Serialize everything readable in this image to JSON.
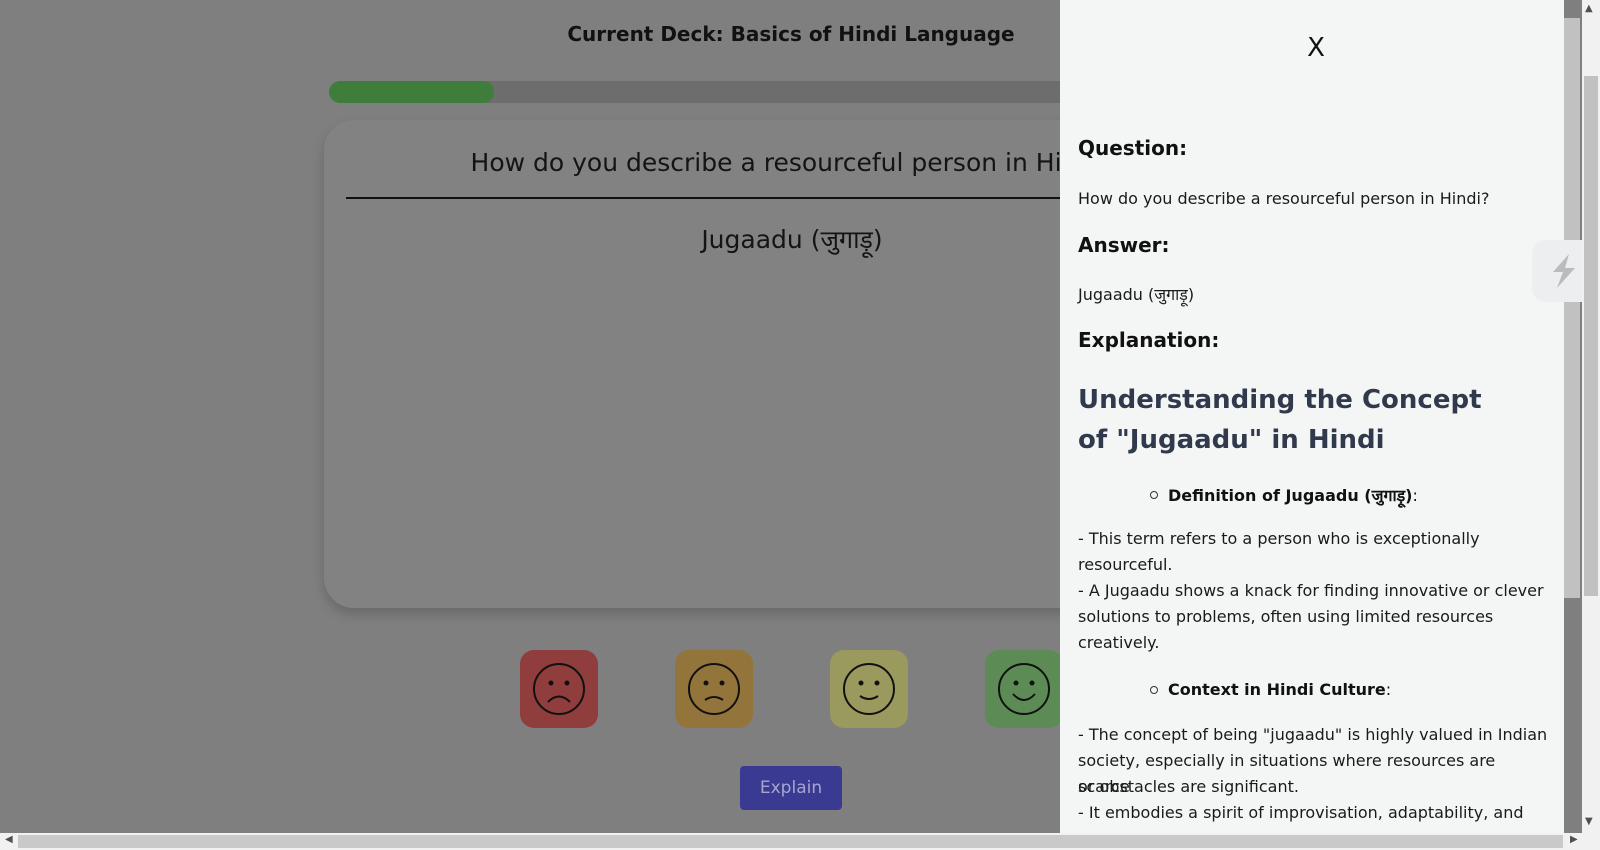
{
  "deck": {
    "title": "Current Deck: Basics of Hindi Language"
  },
  "progress": {
    "fraction": 0.168
  },
  "card": {
    "question": "How do you describe a resourceful person in Hindi?",
    "answer": "Jugaadu (जुगाड़ू)"
  },
  "rating_buttons": [
    {
      "name": "very-sad",
      "color": "#8f3d3d"
    },
    {
      "name": "sad",
      "color": "#93753b"
    },
    {
      "name": "happy",
      "color": "#9a9a5e"
    },
    {
      "name": "very-happy",
      "color": "#5d8b55"
    }
  ],
  "explain_button": {
    "label": "Explain"
  },
  "panel": {
    "close_label": "X",
    "question_heading": "Question:",
    "question_text": "How do you describe a resourceful person in Hindi?",
    "answer_heading": "Answer:",
    "answer_text": "Jugaadu (जुगाड़ू)",
    "explanation_heading": "Explanation:",
    "explanation_title": "Understanding the Concept of \"Jugaadu\" in Hindi",
    "section1_title": "Definition of Jugaadu (जुगाड़ू)",
    "section1_colon": ":",
    "section1_lines": [
      "- This term refers to a person who is exceptionally",
      "resourceful.",
      "- A Jugaadu shows a knack for finding innovative or clever",
      "solutions to problems, often using limited resources",
      "creatively."
    ],
    "section2_title": "Context in Hindi Culture",
    "section2_colon": ":",
    "section2_lines": [
      "- The concept of being \"jugaadu\" is highly valued in Indian",
      "society, especially in situations where resources are scarce",
      "or obstacles are significant.",
      "- It embodies a spirit of improvisation, adaptability, and"
    ]
  },
  "icons": {
    "close": "close-icon",
    "side_widget": "lightning-icon",
    "scroll_up": "▲",
    "scroll_down": "▼",
    "scroll_left": "◀",
    "scroll_right": "▶"
  }
}
